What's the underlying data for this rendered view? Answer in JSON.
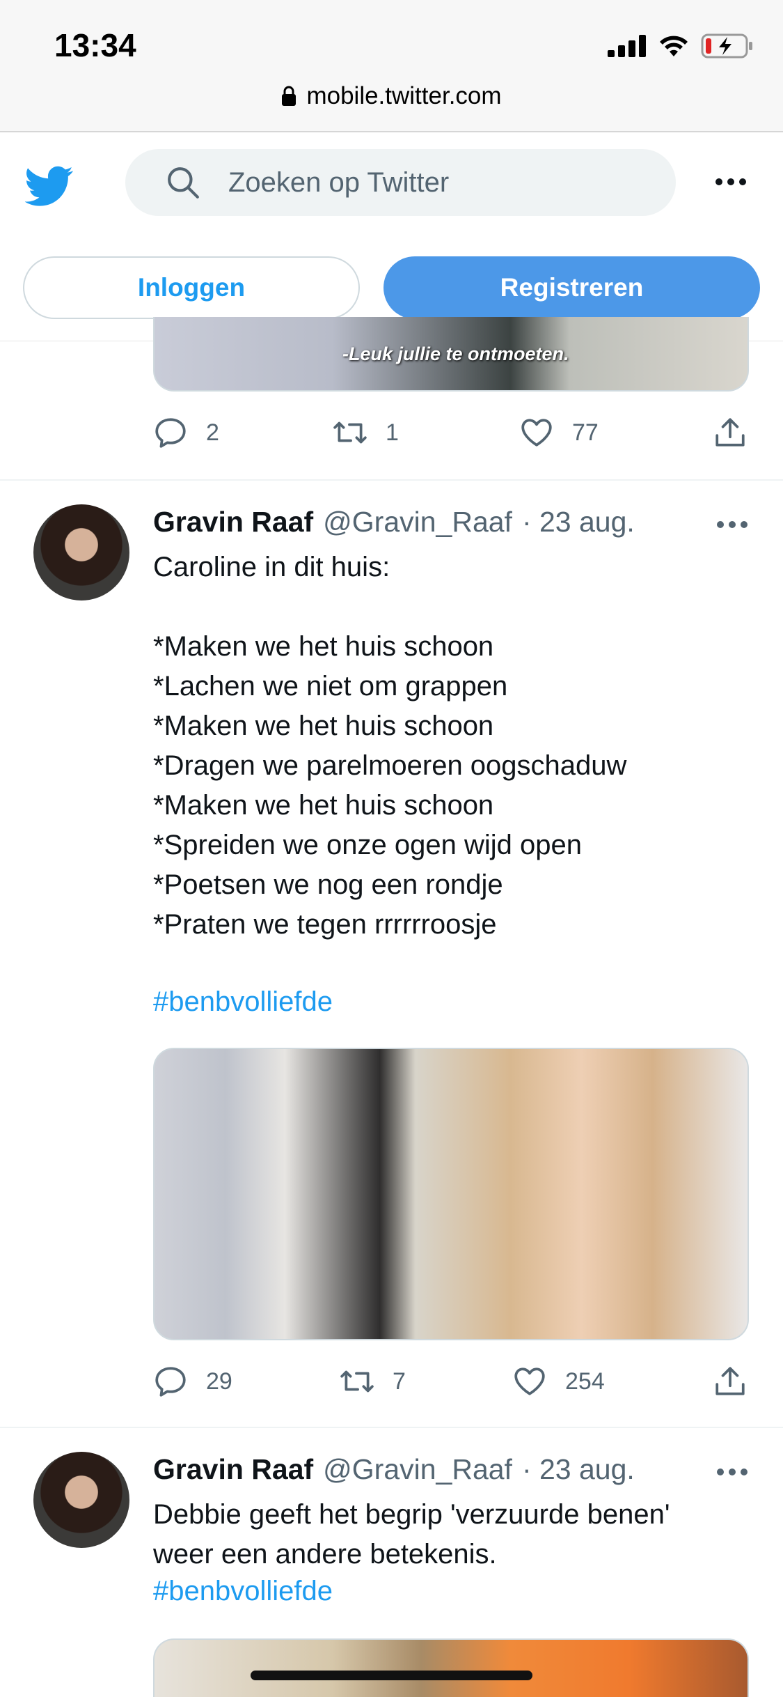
{
  "status_bar": {
    "time": "13:34"
  },
  "browser": {
    "url": "mobile.twitter.com"
  },
  "header": {
    "search_placeholder": "Zoeken op Twitter",
    "login_label": "Inloggen",
    "register_label": "Registreren",
    "accent_color": "#1d9bf0"
  },
  "prev_tweet": {
    "media_caption": "-Leuk jullie te ontmoeten.",
    "replies": "2",
    "retweets": "1",
    "likes": "77"
  },
  "tweets": [
    {
      "name": "Gravin Raaf",
      "handle": "@Gravin_Raaf",
      "date": "· 23 aug.",
      "text": "Caroline in dit huis:\n\n*Maken we het huis schoon\n*Lachen we niet om grappen\n*Maken we het huis schoon\n*Dragen we parelmoeren oogschaduw\n*Maken we het huis schoon\n*Spreiden we onze ogen wijd open\n*Poetsen we nog een rondje\n*Praten we tegen rrrrrroosje",
      "hashtag": "#benbvolliefde",
      "replies": "29",
      "retweets": "7",
      "likes": "254"
    },
    {
      "name": "Gravin Raaf",
      "handle": "@Gravin_Raaf",
      "date": "· 23 aug.",
      "text": "Debbie geeft het begrip 'verzuurde benen'\nweer een andere betekenis.",
      "hashtag": "#benbvolliefde"
    }
  ]
}
